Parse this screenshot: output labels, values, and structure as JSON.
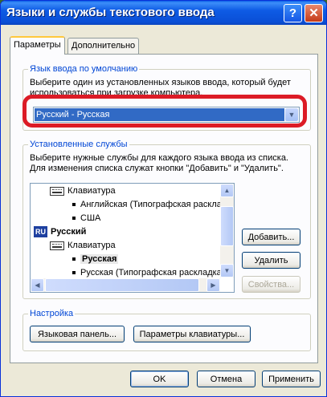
{
  "window": {
    "title": "Языки и службы текстового ввода",
    "help_label": "?",
    "close_label": "✕"
  },
  "tabs": [
    {
      "label": "Параметры",
      "active": true
    },
    {
      "label": "Дополнительно",
      "active": false
    }
  ],
  "default_language": {
    "legend": "Язык ввода по умолчанию",
    "description_line1": "Выберите один из установленных языков ввода, который будет",
    "description_line2": "использоваться при загрузке компьютера.",
    "selected": "Русский - Русская"
  },
  "installed_services": {
    "legend": "Установленные службы",
    "description_line1": "Выберите нужные службы для каждого языка ввода из списка.",
    "description_line2": "Для изменения списка служат кнопки \"Добавить\" и \"Удалить\".",
    "items": [
      {
        "label": "Клавиатура",
        "kind": "keyboard"
      },
      {
        "label": "Английская (Типографская раскладка)",
        "kind": "bullet"
      },
      {
        "label": "США",
        "kind": "bullet"
      },
      {
        "label": "Русский",
        "kind": "language",
        "badge": "RU"
      },
      {
        "label": "Клавиатура",
        "kind": "keyboard"
      },
      {
        "label": "Русская",
        "kind": "bullet-selected"
      },
      {
        "label": "Русская (Типографская раскладка)",
        "kind": "bullet"
      }
    ],
    "buttons": {
      "add": "Добавить...",
      "remove": "Удалить",
      "properties": "Свойства..."
    }
  },
  "settings": {
    "legend": "Настройка",
    "language_bar_button": "Языковая панель...",
    "key_settings_button": "Параметры клавиатуры..."
  },
  "footer": {
    "ok": "OK",
    "cancel": "Отмена",
    "apply": "Применить"
  },
  "colors": {
    "accent_highlight": "#dc1b26",
    "title_bar": "#0a5fe7",
    "legend_text": "#0046d5"
  },
  "icons": [
    "help-icon",
    "close-icon",
    "chevron-down-icon",
    "keyboard-icon",
    "language-ru-icon",
    "bullet-icon",
    "arrow-up-icon",
    "arrow-down-icon",
    "arrow-left-icon",
    "arrow-right-icon"
  ]
}
